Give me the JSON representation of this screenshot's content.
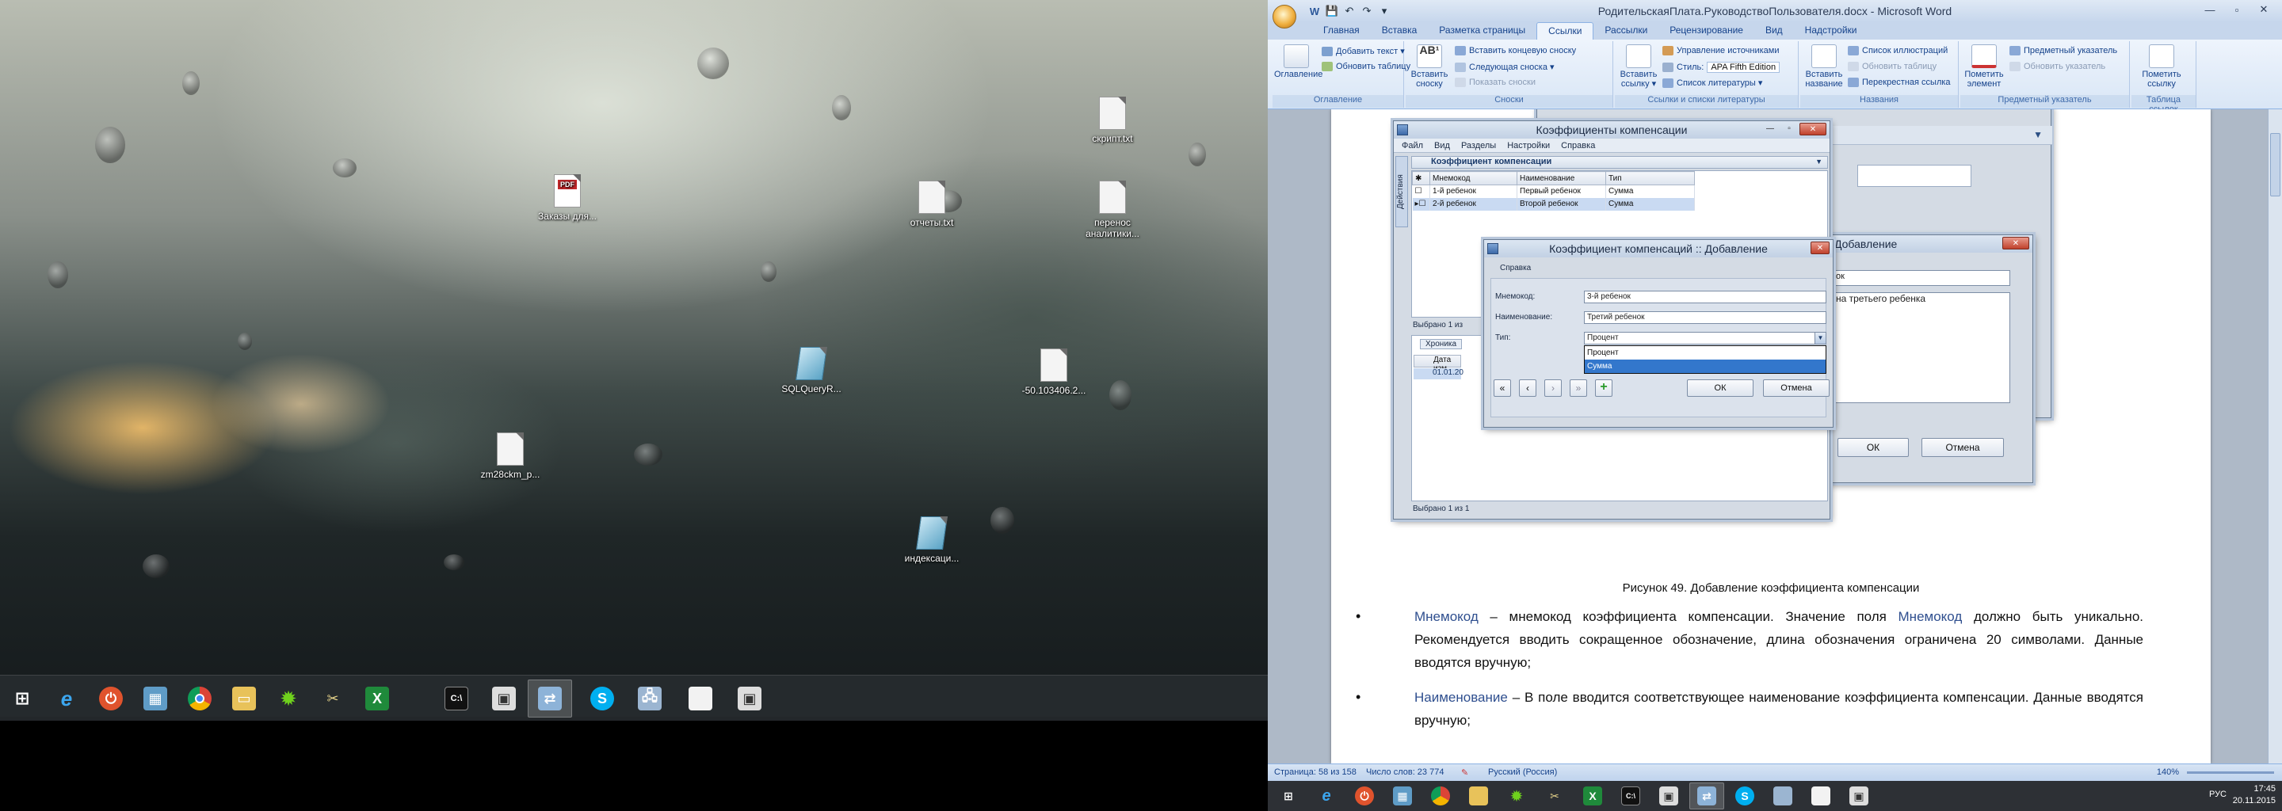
{
  "desktop_left": {
    "icons": [
      {
        "label": "Заказы для...",
        "type": "pdf"
      },
      {
        "label": "отчеты.txt",
        "type": "txt"
      },
      {
        "label": "скрипт.txt",
        "type": "txt"
      },
      {
        "label": "перенос аналитики...",
        "type": "txt"
      },
      {
        "label": "SQLQueryR...",
        "type": "sql"
      },
      {
        "label": "-50.103406.2...",
        "type": "txt"
      },
      {
        "label": "zm28ckm_p...",
        "type": "txt"
      },
      {
        "label": "индексаци...",
        "type": "sql"
      }
    ],
    "taskbar": {
      "start_icon": "windows-start-icon",
      "apps": [
        "internet-explorer",
        "media-player",
        "file-manager",
        "chrome",
        "explorer-folder",
        "green-gear-app",
        "tools",
        "excel",
        "terminal",
        "window-app",
        "remote-app",
        "skype",
        "network-computer",
        "document",
        "window-app-2"
      ],
      "pdf_badge": "PDF"
    }
  },
  "word": {
    "title": "РодительскаяПлата.РуководствоПользователя.docx - Microsoft Word",
    "qat": [
      "W",
      "💾",
      "↶",
      "↷",
      "▾"
    ],
    "window_controls": [
      "—",
      "▫",
      "✕"
    ],
    "tabs": [
      "Главная",
      "Вставка",
      "Разметка страницы",
      "Ссылки",
      "Рассылки",
      "Рецензирование",
      "Вид",
      "Надстройки"
    ],
    "active_tab": "Ссылки",
    "ribbon": {
      "toc": {
        "label": "Оглавление",
        "big": "Оглавление",
        "add_text": "Добавить текст ▾",
        "update_table": "Обновить таблицу"
      },
      "footnotes": {
        "label": "Сноски",
        "big": "Вставить сноску",
        "insert_endnote": "Вставить концевую сноску",
        "next_footnote": "Следующая сноска ▾",
        "show_notes": "Показать сноски"
      },
      "citations": {
        "label": "Ссылки и списки литературы",
        "big": "Вставить ссылку ▾",
        "manage_sources": "Управление источниками",
        "style_label": "Стиль:",
        "style_value": "APA Fifth Edition",
        "bibliography": "Список литературы ▾"
      },
      "captions": {
        "label": "Названия",
        "big": "Вставить название",
        "list_figures": "Список иллюстраций",
        "update_table": "Обновить таблицу",
        "cross_reference": "Перекрестная ссылка"
      },
      "index": {
        "label": "Предметный указатель",
        "big": "Пометить элемент",
        "index": "Предметный указатель",
        "update_index": "Обновить указатель"
      },
      "toa": {
        "label": "Таблица ссылок",
        "big": "Пометить ссылку"
      }
    },
    "document": {
      "caption": "Рисунок 49. Добавление коэффициента компенсации",
      "bullets": [
        {
          "term": "Мнемокод",
          "text_parts": [
            " – мнемокод коэффициента компенсации. Значение поля ",
            "Мнемокод",
            " должно быть уникально. Рекомендуется вводить сокращенное обозначение, длина обозначения ограничена 20 символами. Данные вводятся вручную;"
          ]
        },
        {
          "term": "Наименование",
          "text_parts": [
            " – В поле вводится соответствующее наименование коэффициента компенсации. Данные вводятся вручную;"
          ]
        }
      ]
    },
    "status": {
      "page": "Страница: 58 из 158",
      "words": "Число слов: 23 774",
      "lang": "Русский (Россия)",
      "zoom": "140%"
    }
  },
  "screenshot_in_doc": {
    "back_dialog": {
      "title": "Коэффициенты компенсации",
      "menu": [
        "Файл",
        "Вид",
        "Разделы",
        "Настройки",
        "Справка"
      ],
      "side_tab": "Действия",
      "section_title": "Коэффициент компенсации",
      "columns": [
        "Мнемокод",
        "Наименование",
        "Тип"
      ],
      "rows": [
        [
          "1-й ребенок",
          "Первый ребенок",
          "Сумма"
        ],
        [
          "2-й ребенок",
          "Второй ребенок",
          "Сумма"
        ]
      ],
      "selected_status": "Выбрано 1 из",
      "history_tab": "Хроника",
      "history_cols": [
        "Дата изм"
      ],
      "history_rows": [
        "01.01.20"
      ],
      "bottom_status": "Выбрано 1 из 1"
    },
    "right_dialog": {
      "title": "Добавление",
      "field_value": "ок",
      "notes": "на третьего ребенка",
      "ok": "ОК",
      "cancel": "Отмена"
    },
    "add_dialog": {
      "title": "Коэффициент компенсаций :: Добавление",
      "menu": "Справка",
      "mnemo_label": "Мнемокод:",
      "mnemo_value": "3-й ребенок",
      "name_label": "Наименование:",
      "name_value": "Третий ребенок",
      "type_label": "Тип:",
      "type_value": "Процент",
      "options": [
        "Процент",
        "Сумма"
      ],
      "highlighted_option": "Сумма",
      "nav": [
        "«",
        "‹",
        "›",
        "»",
        "+"
      ],
      "ok": "ОК",
      "cancel": "Отмена"
    }
  },
  "taskbar_right": {
    "lang": "РУС",
    "time": "17:45",
    "date": "20.11.2015"
  }
}
